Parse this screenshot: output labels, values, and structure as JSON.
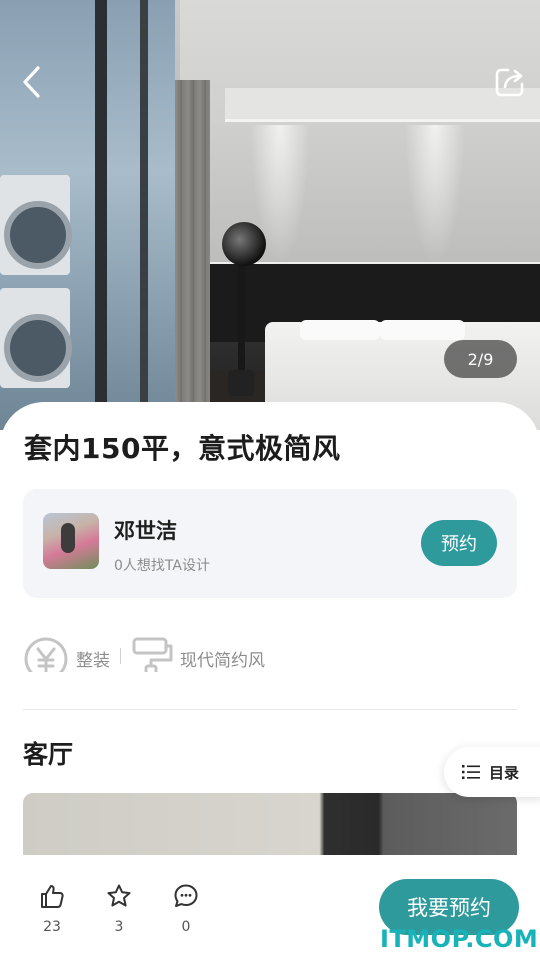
{
  "gallery": {
    "counter": "2/9"
  },
  "project": {
    "title": "套内150平，意式极简风"
  },
  "designer": {
    "name": "邓世洁",
    "subtitle": "0人想找TA设计",
    "reserve_label": "预约"
  },
  "tags": [
    {
      "icon": "yuan-icon",
      "label": "整装"
    },
    {
      "icon": "roller-icon",
      "label": "现代简约风"
    }
  ],
  "section": {
    "title": "客厅"
  },
  "toc": {
    "label": "目录"
  },
  "actions": {
    "likes": "23",
    "favorites": "3",
    "comments": "0"
  },
  "bottom": {
    "reserve_label": "我要预约"
  },
  "watermark": "ITMOP.COM",
  "colors": {
    "accent": "#2f9a9c",
    "watermark": "#18b3b8"
  }
}
